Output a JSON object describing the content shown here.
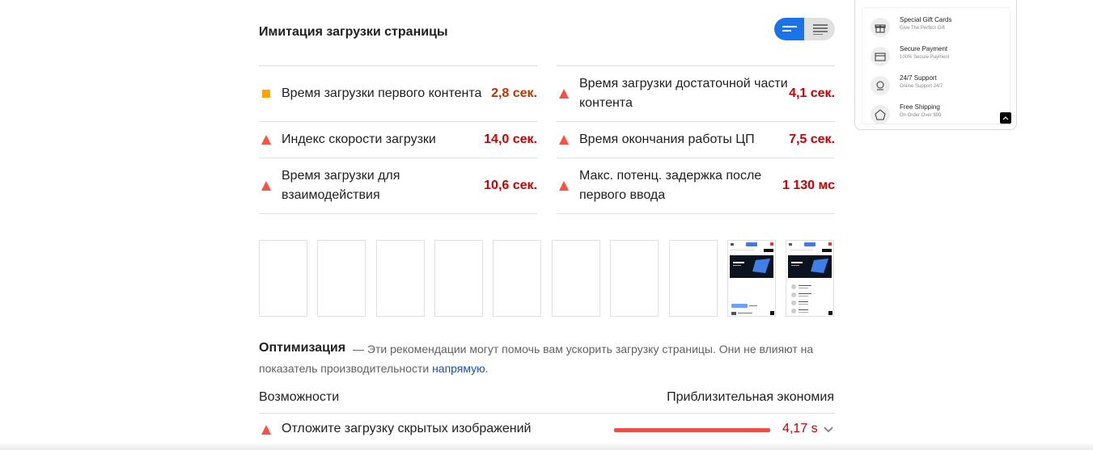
{
  "simulation": {
    "title": "Имитация загрузки страницы"
  },
  "metrics": {
    "left": [
      {
        "label": "Время загрузки первого контента",
        "value": "2,8 сек.",
        "status": "average"
      },
      {
        "label": "Индекс скорости загрузки",
        "value": "14,0 сек.",
        "status": "fail"
      },
      {
        "label": "Время загрузки для взаимодействия",
        "value": "10,6 сек.",
        "status": "fail"
      }
    ],
    "right": [
      {
        "label": "Время загрузки достаточной части контента",
        "value": "4,1 сек.",
        "status": "fail"
      },
      {
        "label": "Время окончания работы ЦП",
        "value": "7,5 сек.",
        "status": "fail"
      },
      {
        "label": "Макс. потенц. задержка после первого ввода",
        "value": "1 130 мс",
        "status": "fail"
      }
    ]
  },
  "filmstrip": {
    "frame_count": 10,
    "populated_frames": 2
  },
  "optimization": {
    "title": "Оптимизация",
    "description_prefix": "— Эти рекомендации могут помочь вам ускорить загрузку страницы. Они не влияют на показатель производительности",
    "link_text": "напрямую",
    "description_suffix": ".",
    "opportunities_header": "Возможности",
    "savings_header": "Приблизительная экономия",
    "items": [
      {
        "label": "Отложите загрузку скрытых изображений",
        "value": "4,17 s",
        "bar_fraction": 1.0
      }
    ]
  },
  "side_card": {
    "features": [
      {
        "title": "Special Gift Cards",
        "subtitle": "Give The Perfect Gift",
        "icon": "gift-icon"
      },
      {
        "title": "Secure Payment",
        "subtitle": "100% Secure Payment",
        "icon": "payment-icon"
      },
      {
        "title": "24/7 Support",
        "subtitle": "Online Support 24/7",
        "icon": "support-icon"
      },
      {
        "title": "Free Shipping",
        "subtitle": "On Order Over $99",
        "icon": "shipping-icon"
      }
    ]
  },
  "colors": {
    "fail": "#ff4e42",
    "average": "#ffa400",
    "fail_text": "#cc0000",
    "average_text": "#c33300",
    "accent": "#1a73e8"
  }
}
